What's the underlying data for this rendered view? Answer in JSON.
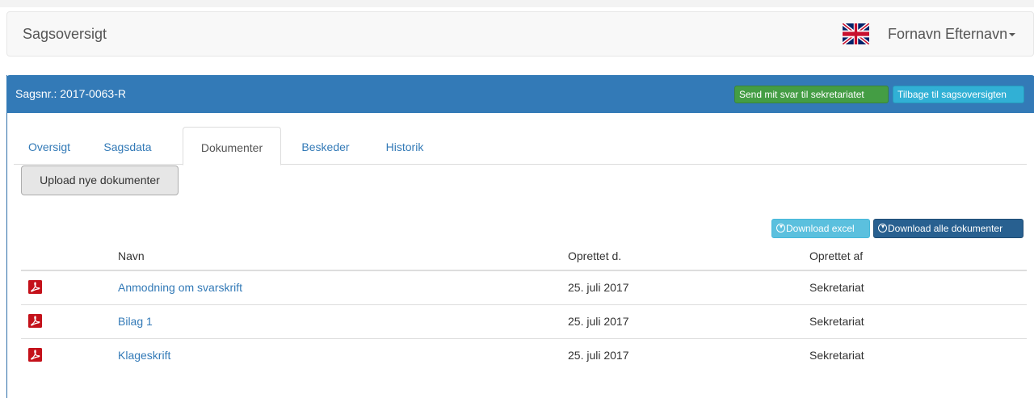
{
  "navbar": {
    "brand": "Sagsoversigt",
    "language_icon": "uk-flag-icon",
    "user_name": "Fornavn Efternavn"
  },
  "panel": {
    "case_number": "Sagsnr.: 2017-0063-R",
    "send_button": "Send mit svar til sekretariatet",
    "back_button": "Tilbage til sagsoversigten"
  },
  "tabs": [
    {
      "label": "Oversigt",
      "active": false
    },
    {
      "label": "Sagsdata",
      "active": false
    },
    {
      "label": "Dokumenter",
      "active": true
    },
    {
      "label": "Beskeder",
      "active": false
    },
    {
      "label": "Historik",
      "active": false
    }
  ],
  "upload_button": "Upload nye dokumenter",
  "download": {
    "excel": "Download excel",
    "all": "Download alle dokumenter"
  },
  "table": {
    "columns": [
      "Navn",
      "Oprettet d.",
      "Oprettet af"
    ],
    "rows": [
      {
        "name": "Anmodning om svarskrift",
        "created": "25. juli 2017",
        "created_by": "Sekretariat",
        "icon": "pdf-icon"
      },
      {
        "name": "Bilag 1",
        "created": "25. juli 2017",
        "created_by": "Sekretariat",
        "icon": "pdf-icon"
      },
      {
        "name": "Klageskrift",
        "created": "25. juli 2017",
        "created_by": "Sekretariat",
        "icon": "pdf-icon"
      }
    ]
  },
  "colors": {
    "primary": "#337ab7",
    "success": "#449d44",
    "info": "#5bc0de",
    "pdf_red": "#c4111a"
  }
}
